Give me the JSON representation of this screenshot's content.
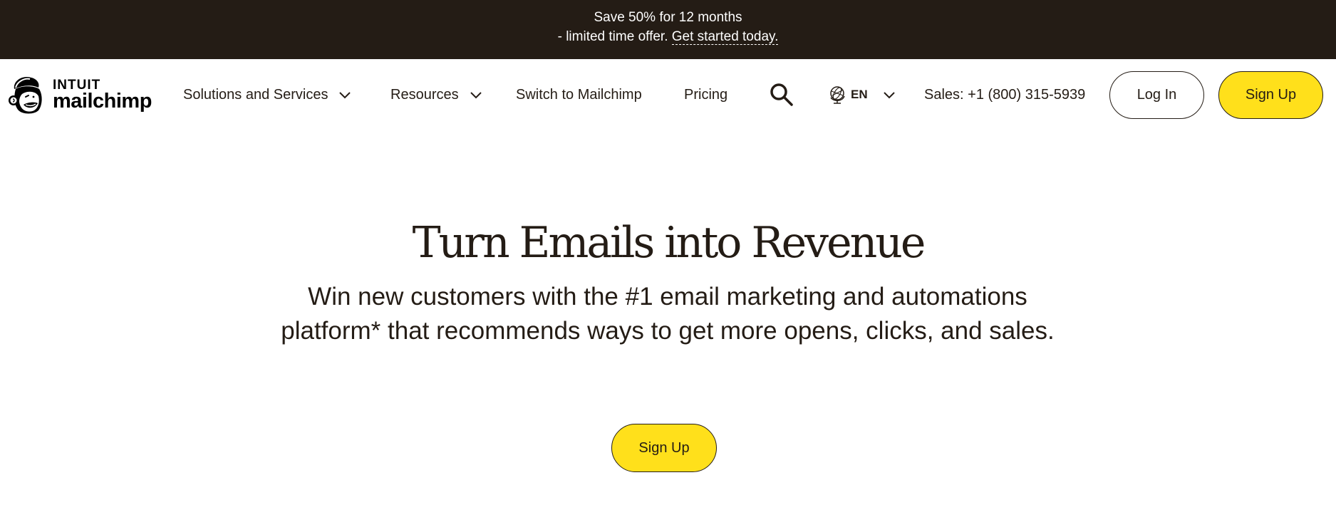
{
  "promo_banner": {
    "line1": "Save 50% for 12 months",
    "line2_prefix": "- limited time offer. ",
    "link_text": "Get started today."
  },
  "header": {
    "logo": {
      "brand_top": "INTUIT",
      "brand_bottom": "mailchimp",
      "icon": "freddie-monkey-icon"
    },
    "nav_items": [
      {
        "label": "Solutions and Services",
        "has_dropdown": true
      },
      {
        "label": "Resources",
        "has_dropdown": true
      },
      {
        "label": "Switch to Mailchimp",
        "has_dropdown": false
      },
      {
        "label": "Pricing",
        "has_dropdown": false
      }
    ],
    "search_icon": "search-icon",
    "language": {
      "icon": "globe-icon",
      "selected": "EN"
    },
    "sales_phone": "Sales: +1 (800) 315-5939",
    "login_label": "Log In",
    "signup_label": "Sign Up"
  },
  "hero": {
    "title": "Turn Emails into Revenue",
    "subtitle": "Win new customers with the #1 email marketing and automations platform* that recommends ways to get more opens, clicks, and sales.",
    "cta_label": "Sign Up"
  },
  "colors": {
    "banner_bg": "#241c15",
    "text": "#241c15",
    "accent_yellow": "#ffe01b",
    "background": "#ffffff"
  }
}
